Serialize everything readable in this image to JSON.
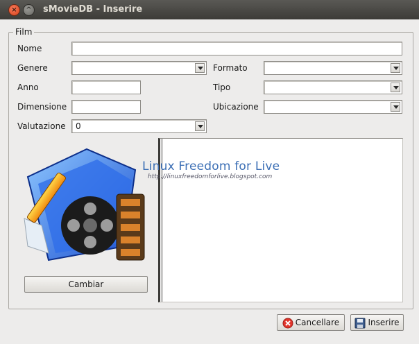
{
  "window": {
    "title": "sMovieDB - Inserire"
  },
  "frame": {
    "legend": "Film"
  },
  "fields": {
    "nome_label": "Nome",
    "genere_label": "Genere",
    "formato_label": "Formato",
    "anno_label": "Anno",
    "tipo_label": "Tipo",
    "dimensione_label": "Dimensione",
    "ubicazione_label": "Ubicazione",
    "valutazione_label": "Valutazione",
    "valutazione_value": "0"
  },
  "buttons": {
    "cambiar": "Cambiar",
    "cancellare": "Cancellare",
    "inserire": "Inserire"
  },
  "watermark": {
    "title": "Linux Freedom for Live",
    "url": "http://linuxfreedomforlive.blogspot.com"
  },
  "icons": {
    "close": "close-icon",
    "maximize": "maximize-icon",
    "poster": "movie-folder-icon",
    "cancel": "cancel-icon",
    "save": "save-icon"
  }
}
